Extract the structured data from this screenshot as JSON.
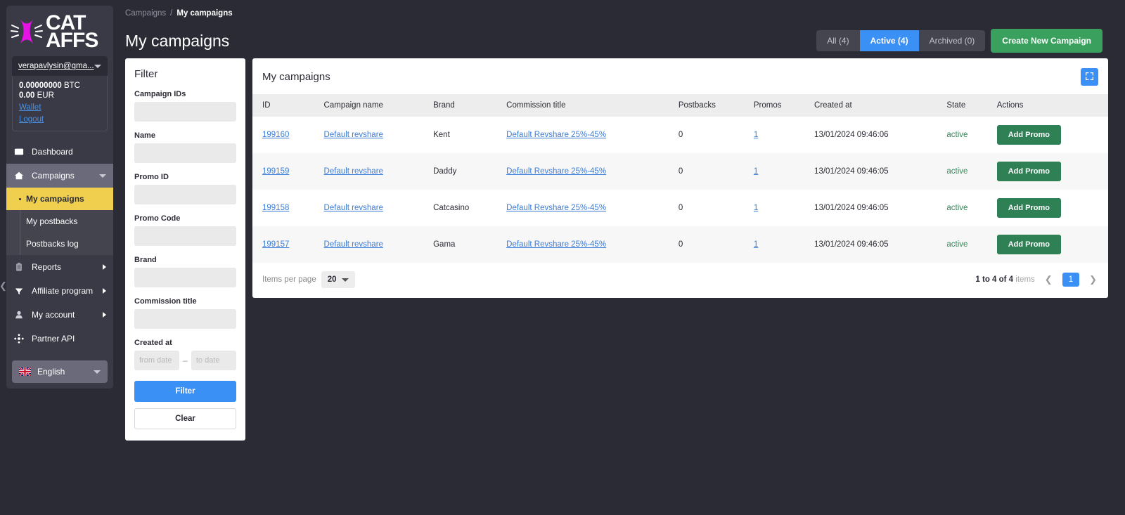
{
  "brand": {
    "logo_line1": "CAT",
    "logo_line2": "AFFS",
    "logo_color": "#e612e6"
  },
  "account": {
    "email": "verapavlysin@gma...",
    "balance_btc": "0.00000000",
    "balance_btc_unit": "BTC",
    "balance_eur": "0.00",
    "balance_eur_unit": "EUR",
    "wallet_link": "Wallet",
    "logout_link": "Logout"
  },
  "sidebar": {
    "items": [
      {
        "label": "Dashboard",
        "icon": "monitor-icon",
        "has_arrow": false
      },
      {
        "label": "Campaigns",
        "icon": "home-icon",
        "has_arrow": false,
        "expanded": true
      },
      {
        "label": "Reports",
        "icon": "clipboard-icon",
        "has_arrow": true
      },
      {
        "label": "Affiliate program",
        "icon": "funnel-icon",
        "has_arrow": true
      },
      {
        "label": "My account",
        "icon": "person-icon",
        "has_arrow": true
      },
      {
        "label": "Partner API",
        "icon": "api-nodes-icon",
        "has_arrow": false
      }
    ],
    "campaigns_children": [
      {
        "label": "My campaigns",
        "selected": true
      },
      {
        "label": "My postbacks",
        "selected": false
      },
      {
        "label": "Postbacks log",
        "selected": false
      }
    ],
    "language": {
      "label": "English",
      "icon": "uk-flag-icon"
    },
    "collapse_icon": "chevron-left-icon"
  },
  "header": {
    "breadcrumb_parent": "Campaigns",
    "breadcrumb_separator": "/",
    "breadcrumb_current": "My campaigns",
    "page_title": "My campaigns",
    "tabs": [
      {
        "label": "All (4)",
        "active": false
      },
      {
        "label": "Active (4)",
        "active": true
      },
      {
        "label": "Archived (0)",
        "active": false
      }
    ],
    "create_button": "Create New Campaign"
  },
  "filter": {
    "title": "Filter",
    "fields": [
      {
        "label": "Campaign IDs",
        "value": "",
        "placeholder": ""
      },
      {
        "label": "Name",
        "value": "",
        "placeholder": ""
      },
      {
        "label": "Promo ID",
        "value": "",
        "placeholder": ""
      },
      {
        "label": "Promo Code",
        "value": "",
        "placeholder": ""
      },
      {
        "label": "Brand",
        "value": "",
        "placeholder": ""
      },
      {
        "label": "Commission title",
        "value": "",
        "placeholder": ""
      }
    ],
    "created_at_label": "Created at",
    "date_from_placeholder": "from date",
    "date_to_placeholder": "to date",
    "date_separator": "–",
    "filter_button": "Filter",
    "clear_button": "Clear"
  },
  "table": {
    "card_title": "My campaigns",
    "expand_icon": "fullscreen-icon",
    "columns": [
      "ID",
      "Campaign name",
      "Brand",
      "Commission title",
      "Postbacks",
      "Promos",
      "Created at",
      "State",
      "Actions"
    ],
    "rows": [
      {
        "id": "199160",
        "campaign_name": "Default revshare",
        "brand": "Kent",
        "commission_title": "Default Revshare 25%-45%",
        "postbacks": "0",
        "promos": "1",
        "created_at": "13/01/2024 09:46:06",
        "state": "active",
        "action": "Add Promo"
      },
      {
        "id": "199159",
        "campaign_name": "Default revshare",
        "brand": "Daddy",
        "commission_title": "Default Revshare 25%-45%",
        "postbacks": "0",
        "promos": "1",
        "created_at": "13/01/2024 09:46:05",
        "state": "active",
        "action": "Add Promo"
      },
      {
        "id": "199158",
        "campaign_name": "Default revshare",
        "brand": "Catcasino",
        "commission_title": "Default Revshare 25%-45%",
        "postbacks": "0",
        "promos": "1",
        "created_at": "13/01/2024 09:46:05",
        "state": "active",
        "action": "Add Promo"
      },
      {
        "id": "199157",
        "campaign_name": "Default revshare",
        "brand": "Gama",
        "commission_title": "Default Revshare 25%-45%",
        "postbacks": "0",
        "promos": "1",
        "created_at": "13/01/2024 09:46:05",
        "state": "active",
        "action": "Add Promo"
      }
    ],
    "footer": {
      "items_per_page_label": "Items per page",
      "items_per_page_value": "20",
      "range_text": "1 to 4 of 4",
      "items_word": "items",
      "prev_icon": "chevron-left-icon",
      "next_icon": "chevron-right-icon",
      "current_page": "1"
    }
  },
  "colors": {
    "accent_blue": "#3b90f5",
    "green": "#3aa05e",
    "dark_green": "#2f8055",
    "yellow": "#f0ce4e",
    "dark_bg": "#2b2b35",
    "panel_bg": "#3a3a47",
    "link_blue": "#3b7dd8",
    "state_green": "#2e8b57"
  }
}
